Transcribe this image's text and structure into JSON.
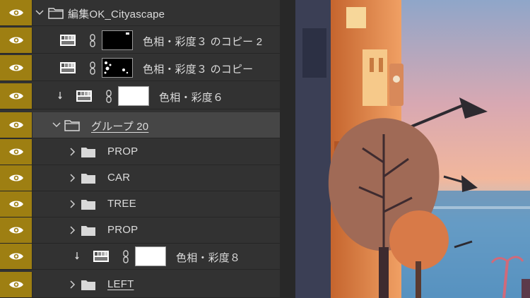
{
  "layers": [
    {
      "id": "group-cityscape",
      "kind": "group",
      "label": "編集OK_Cityascape",
      "expanded": true,
      "indent": 0,
      "visible": true
    },
    {
      "id": "hue-copy-2",
      "kind": "adjustment",
      "label": "色相・彩度３ のコピー 2",
      "mask": "black",
      "clipped": false,
      "indent": 1,
      "visible": true
    },
    {
      "id": "hue-copy",
      "kind": "adjustment",
      "label": "色相・彩度３ のコピー",
      "mask": "black-speckled",
      "clipped": false,
      "indent": 1,
      "visible": true
    },
    {
      "id": "hue-6",
      "kind": "adjustment",
      "label": "色相・彩度６",
      "mask": "white",
      "clipped": true,
      "indent": 1,
      "visible": true
    },
    {
      "id": "group-20",
      "kind": "group",
      "label": "グループ 20",
      "expanded": true,
      "indent": 1,
      "visible": true,
      "selected": true,
      "underline": true
    },
    {
      "id": "prop-1",
      "kind": "group",
      "label": "PROP",
      "expanded": false,
      "indent": 2,
      "visible": true
    },
    {
      "id": "car",
      "kind": "group",
      "label": "CAR",
      "expanded": false,
      "indent": 2,
      "visible": true
    },
    {
      "id": "tree",
      "kind": "group",
      "label": "TREE",
      "expanded": false,
      "indent": 2,
      "visible": true
    },
    {
      "id": "prop-2",
      "kind": "group",
      "label": "PROP",
      "expanded": false,
      "indent": 2,
      "visible": true
    },
    {
      "id": "hue-8",
      "kind": "adjustment",
      "label": "色相・彩度８",
      "mask": "white",
      "clipped": true,
      "indent": 2,
      "visible": true
    },
    {
      "id": "left",
      "kind": "group",
      "label": "LEFT",
      "expanded": false,
      "indent": 2,
      "visible": true,
      "underline": true
    }
  ],
  "colors": {
    "panel": "#323232",
    "visibility_column": "#9e7f12",
    "selected_row": "#464646",
    "text": "#dcdcdc"
  },
  "icons": {
    "visibility": "eye-icon",
    "expand": "chevron-icon",
    "group": "folder-icon",
    "adjustment": "hue-saturation-icon",
    "mask_link": "chain-link-icon",
    "clipping": "clipping-arrow-icon"
  }
}
